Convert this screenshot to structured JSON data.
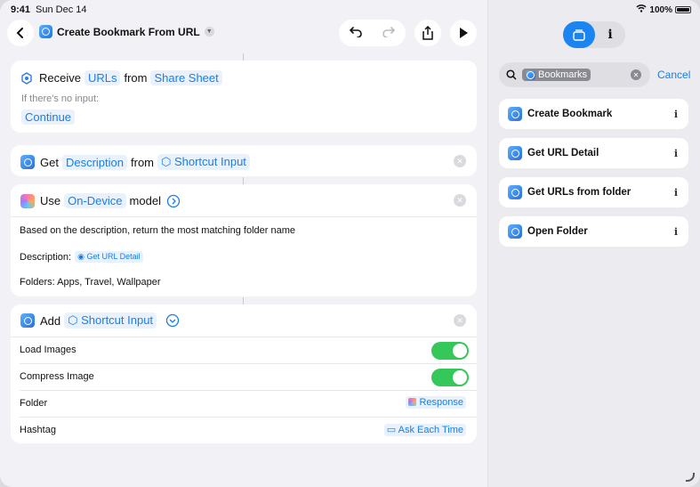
{
  "status": {
    "time": "9:41",
    "date": "Sun Dec 14",
    "battery": "100%"
  },
  "header": {
    "title": "Create Bookmark From URL"
  },
  "receive": {
    "verb": "Receive",
    "type": "URLs",
    "from": "from",
    "source": "Share Sheet",
    "no_input_label": "If there's no input:",
    "no_input_action": "Continue"
  },
  "get": {
    "verb": "Get",
    "property": "Description",
    "from": "from",
    "source": "Shortcut Input"
  },
  "use": {
    "verb": "Use",
    "model_type": "On-Device",
    "model_word": "model",
    "prompt": "Based on the description, return the most matching folder name",
    "desc_label": "Description:",
    "desc_token": "Get URL Detail",
    "folders": "Folders: Apps, Travel, Wallpaper"
  },
  "add": {
    "verb": "Add",
    "input": "Shortcut Input",
    "params": [
      {
        "label": "Load Images",
        "type": "toggle",
        "on": true
      },
      {
        "label": "Compress Image",
        "type": "toggle",
        "on": true
      },
      {
        "label": "Folder",
        "value": "Response"
      },
      {
        "label": "Hashtag",
        "value": "Ask Each Time"
      }
    ]
  },
  "sidebar": {
    "search_tag": "Bookmarks",
    "cancel": "Cancel",
    "items": [
      "Create Bookmark",
      "Get URL Detail",
      "Get URLs from folder",
      "Open Folder"
    ]
  },
  "colors": {
    "accent": "#1a84f0",
    "toggle_on": "#34c759",
    "token_text": "#1a7ee6"
  }
}
